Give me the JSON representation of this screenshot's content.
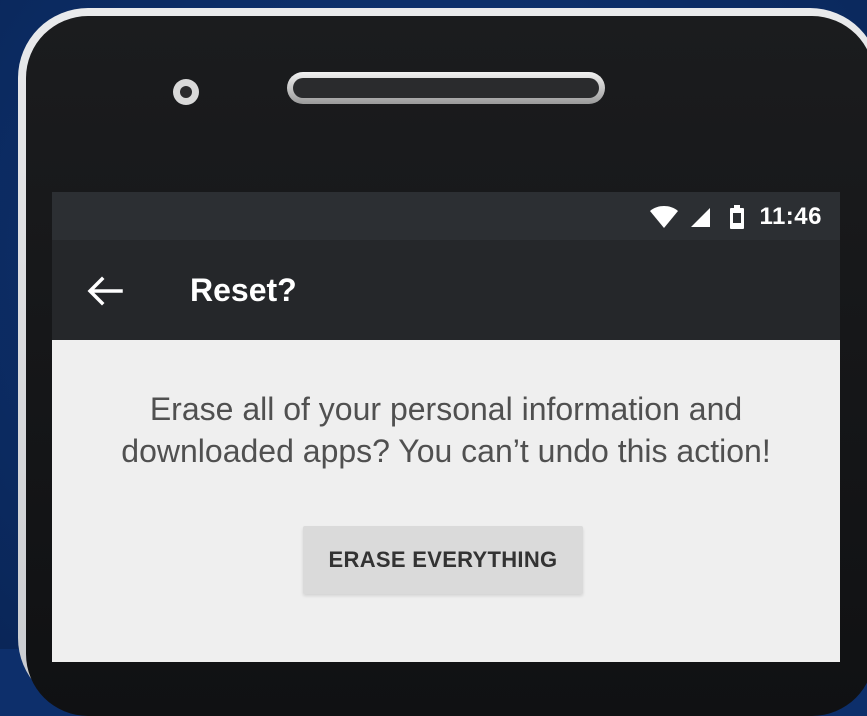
{
  "colors": {
    "background": "#0d2f6b",
    "status_bar": "#2c2f33",
    "app_bar": "#25272a",
    "screen": "#efefef",
    "button": "#dadada",
    "text_primary": "#505050"
  },
  "status_bar": {
    "icons": [
      "wifi-icon",
      "cell-signal-icon",
      "battery-icon"
    ],
    "time": "11:46"
  },
  "app_bar": {
    "back_icon": "arrow-left-icon",
    "title": "Reset?"
  },
  "content": {
    "message_line1": "Erase all of your personal information and",
    "message_line2": "downloaded apps? You can’t undo this action!",
    "erase_button_label": "ERASE EVERYTHING"
  }
}
